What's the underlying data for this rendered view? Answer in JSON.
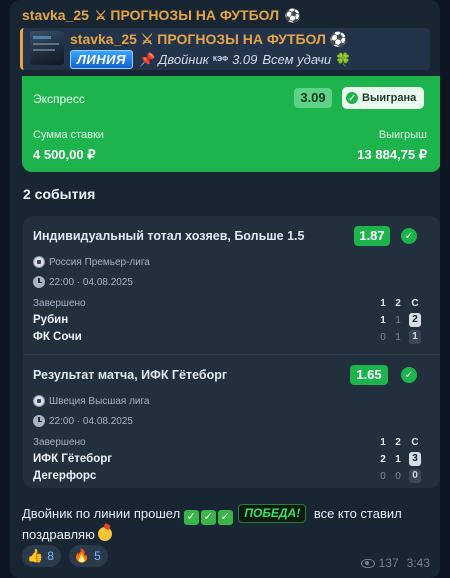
{
  "message": {
    "author": "stavka_25",
    "author_suffix": "ПРОГНОЗЫ НА ФУТБОЛ",
    "reply": {
      "title": "stavka_25",
      "title_suffix": "ПРОГНОЗЫ НА ФУТБОЛ",
      "badge": "ЛИНИЯ",
      "text": "Двойник",
      "kef_label": "КЭФ",
      "kef_value": "3.09",
      "wish": "Всем удачи"
    },
    "express": {
      "label": "Экспресс",
      "coef": "3.09",
      "status": "Выиграна",
      "stake_label": "Сумма ставки",
      "stake_value": "4 500,00 ₽",
      "win_label": "Выигрыш",
      "win_value": "13 884,75 ₽"
    },
    "events_title": "2 события",
    "events": [
      {
        "title": "Индивидуальный тотал хозяев, Больше 1.5",
        "coef": "1.87",
        "league": "Россия Премьер-лига",
        "datetime": "22:00 · 04.08.2025",
        "status": "Завершено",
        "headers": [
          "1",
          "2",
          "С"
        ],
        "teams": [
          {
            "name": "Рубин",
            "s1": "1",
            "s2": "1",
            "total": "2",
            "winner": true
          },
          {
            "name": "ФК Сочи",
            "s1": "0",
            "s2": "1",
            "total": "1",
            "winner": false
          }
        ]
      },
      {
        "title": "Результат матча, ИФК Гётеборг",
        "coef": "1.65",
        "league": "Швеция Высшая лига",
        "datetime": "22:00 · 04.08.2025",
        "status": "Завершено",
        "headers": [
          "1",
          "2",
          "С"
        ],
        "teams": [
          {
            "name": "ИФК Гётеборг",
            "s1": "2",
            "s2": "1",
            "total": "3",
            "winner": true
          },
          {
            "name": "Дегерфорс",
            "s1": "0",
            "s2": "0",
            "total": "0",
            "winner": false
          }
        ]
      }
    ],
    "text_part1": "Двойник по линии прошел",
    "pobeda": "ПОБЕДА!",
    "text_part2": "все кто ставил",
    "text_part3": "поздравляю",
    "reactions": [
      {
        "icon": "thumbs-up-icon",
        "glyph": "👍",
        "count": "8"
      },
      {
        "icon": "fire-icon",
        "glyph": "🔥",
        "count": "5"
      }
    ],
    "views": "137",
    "time": "3:43"
  },
  "colors": {
    "background": "#0e1621",
    "bubble": "#182533",
    "author": "#e5a64a",
    "win_green": "#1db44e",
    "card": "#222f3d"
  }
}
